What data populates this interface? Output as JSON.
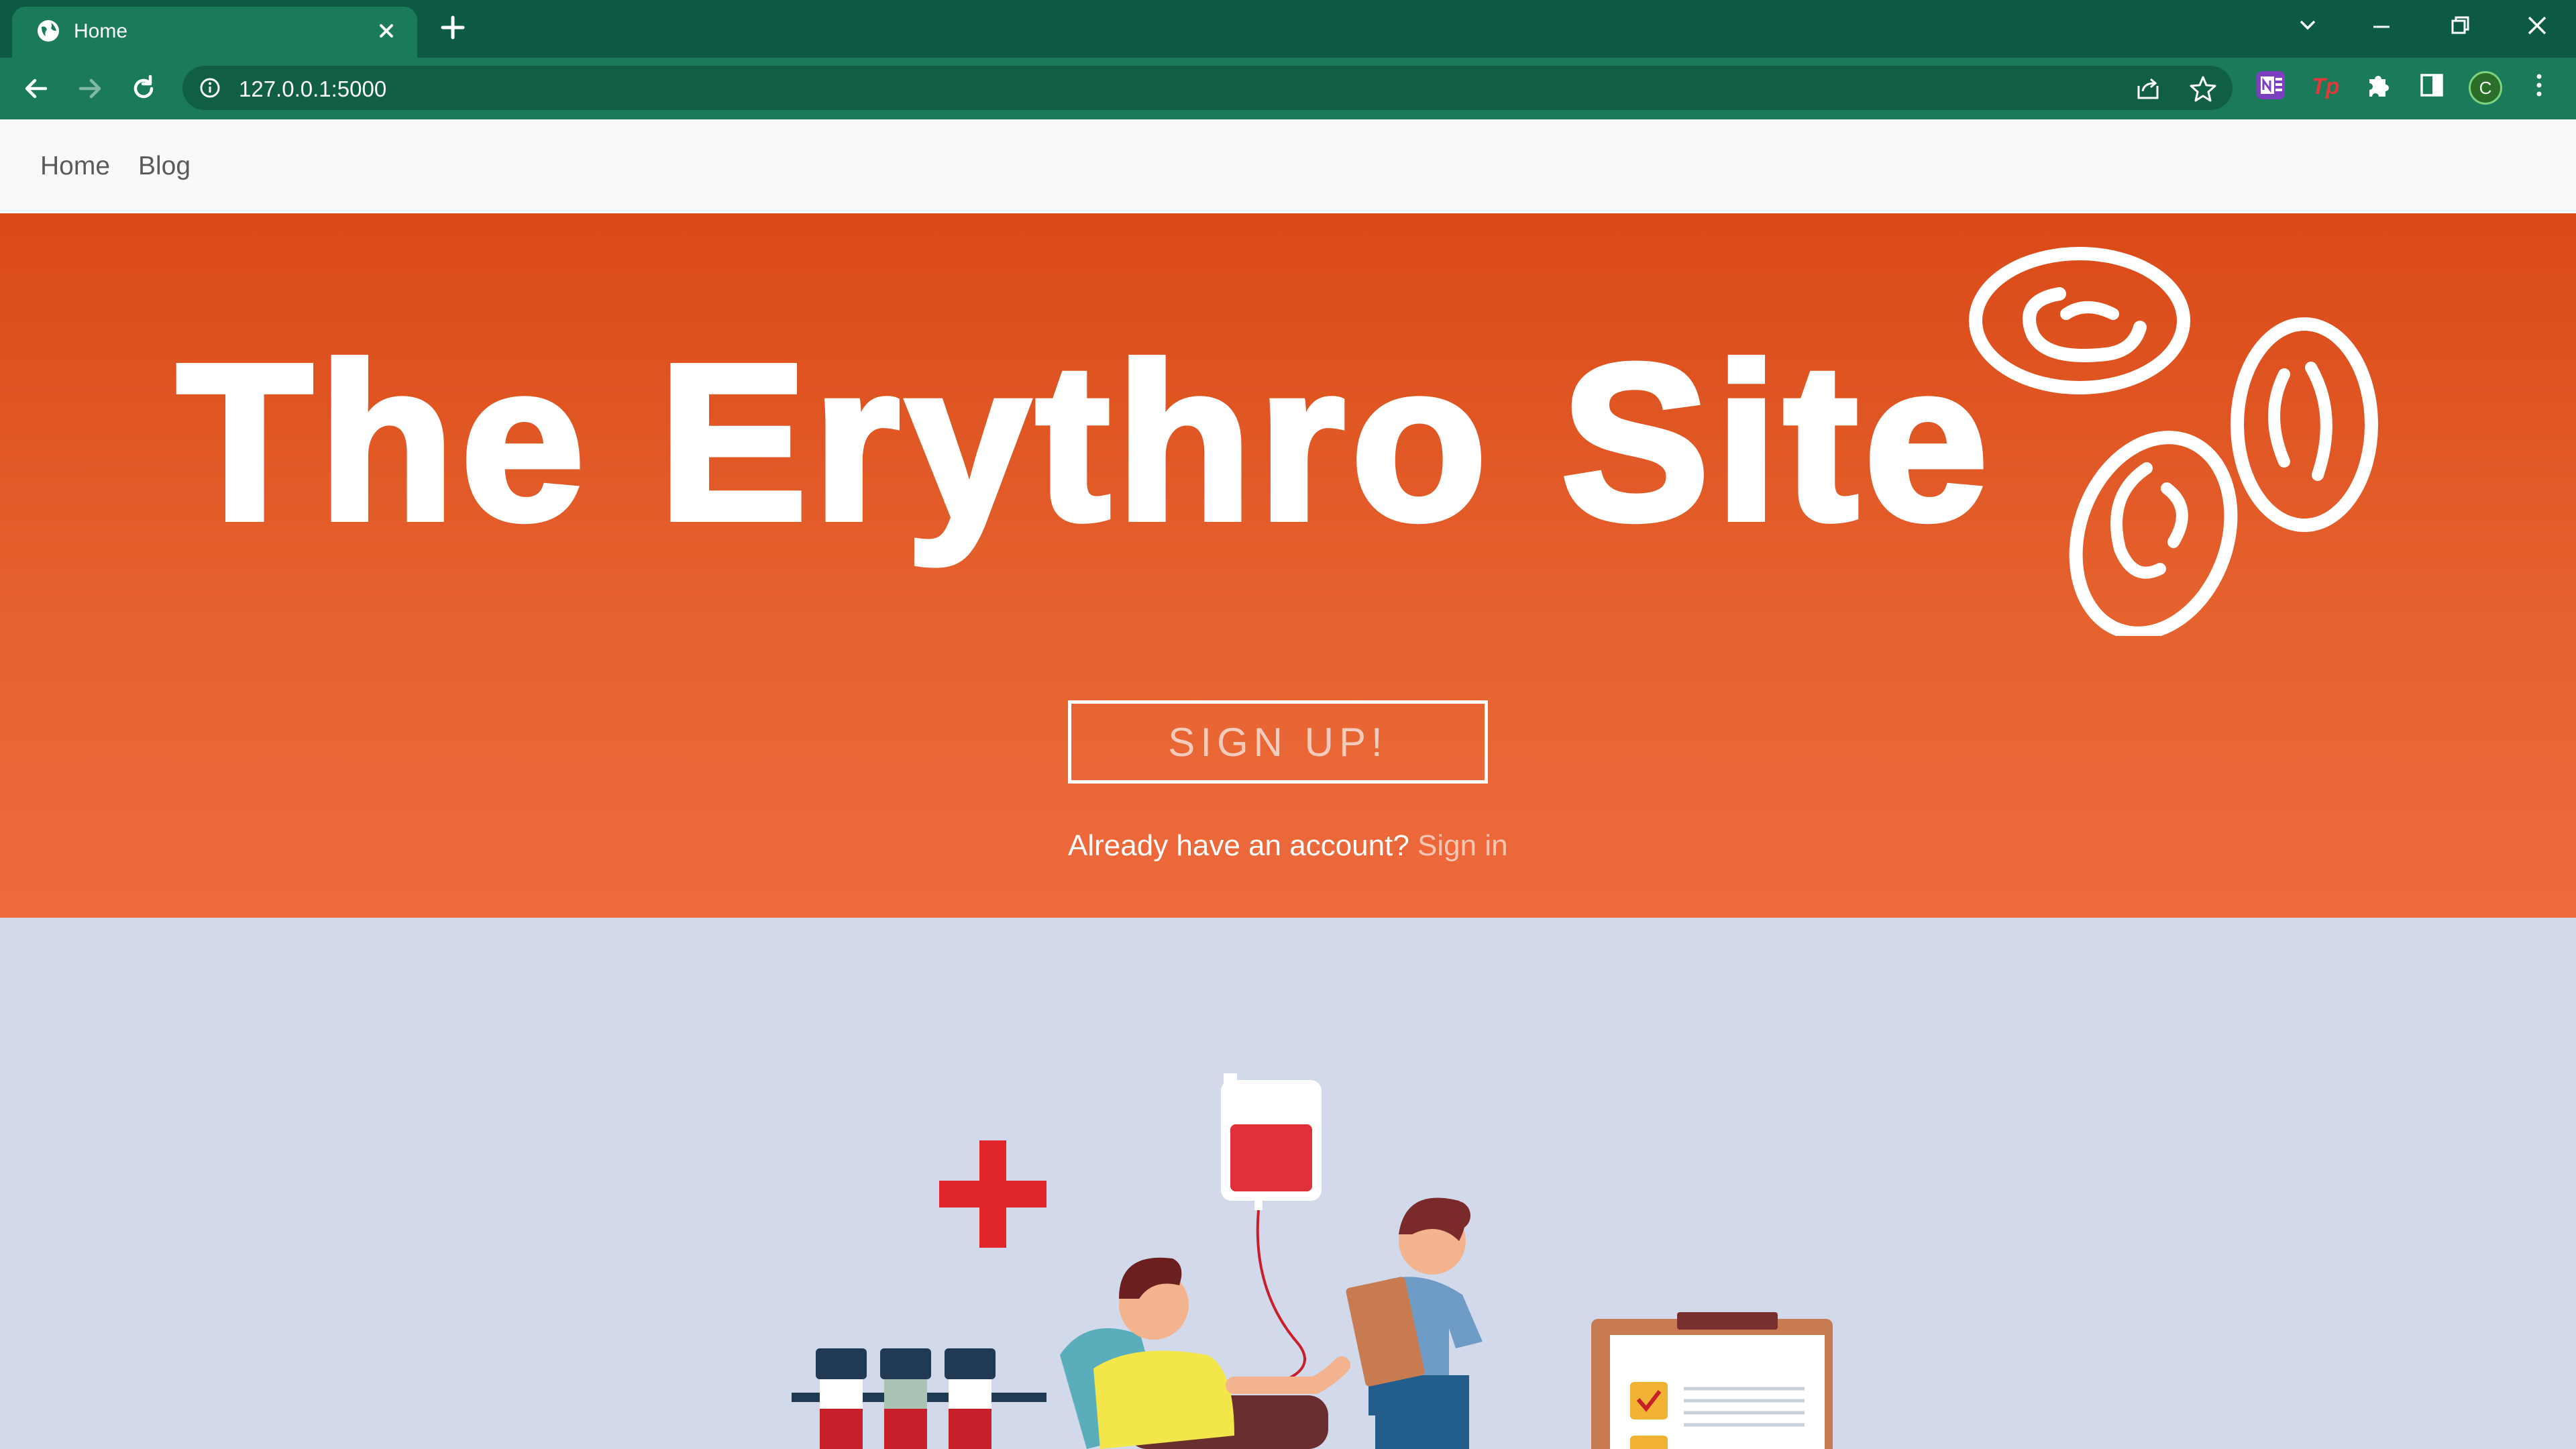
{
  "browser": {
    "tab_title": "Home",
    "url": "127.0.0.1:5000",
    "profile_initial": "C"
  },
  "nav": {
    "links": [
      "Home",
      "Blog"
    ]
  },
  "hero": {
    "title": "The Erythro Site",
    "signup_label": "SIGN UP!",
    "signin_prompt": "Already have an account?",
    "signin_link": "Sign in"
  },
  "colors": {
    "chrome_dark": "#0c5a43",
    "chrome_tab": "#1a7a59",
    "hero_top": "#da4a18",
    "hero_bottom": "#ee6a3e",
    "page_bg": "#d2d9eb"
  }
}
